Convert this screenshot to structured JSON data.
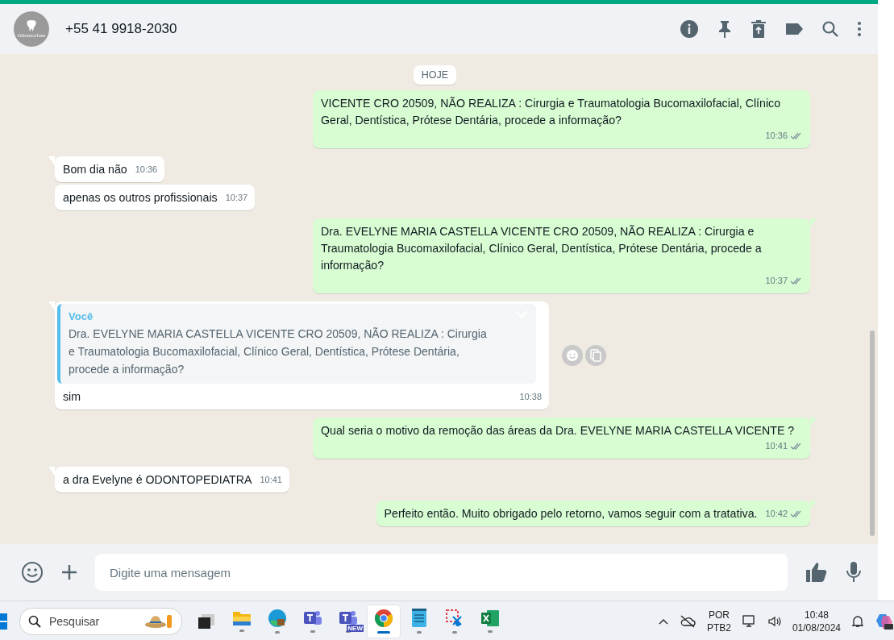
{
  "header": {
    "avatar_label": "Odontoclass",
    "title": "+55 41 9918-2030"
  },
  "date_chip": "HOJE",
  "messages": [
    {
      "kind": "out",
      "tail": false,
      "text": "VICENTE CRO 20509, NÃO REALIZA : Cirurgia e Traumatologia Bucomaxilofacial, Clínico Geral, Dentística, Prótese Dentária, procede a informação?",
      "time": "10:36"
    },
    {
      "kind": "in",
      "tail": true,
      "text": "Bom dia não",
      "time": "10:36"
    },
    {
      "kind": "in",
      "tail": false,
      "text": "apenas os outros profissionais",
      "time": "10:37"
    },
    {
      "kind": "out",
      "tail": true,
      "text": "Dra. EVELYNE MARIA CASTELLA VICENTE CRO 20509, NÃO REALIZA : Cirurgia e Traumatologia Bucomaxilofacial, Clínico Geral, Dentística, Prótese Dentária, procede a informação?",
      "time": "10:37"
    },
    {
      "kind": "quote",
      "tail": true,
      "quote_author": "Você",
      "quote_text": "Dra. EVELYNE MARIA CASTELLA VICENTE CRO 20509, NÃO REALIZA : Cirurgia e Traumatologia Bucomaxilofacial, Clínico Geral, Dentística, Prótese Dentária, procede a informação?",
      "text": "sim",
      "time": "10:38"
    },
    {
      "kind": "out",
      "tail": true,
      "text": "Qual seria o motivo da remoção das áreas da Dra. EVELYNE MARIA CASTELLA VICENTE ?",
      "time": "10:41"
    },
    {
      "kind": "in",
      "tail": true,
      "text": "a dra Evelyne é ODONTOPEDIATRA",
      "time": "10:41"
    },
    {
      "kind": "out",
      "tail": true,
      "text": "Perfeito então. Muito obrigado pelo retorno, vamos seguir com a tratativa.",
      "time": "10:42"
    }
  ],
  "composer": {
    "placeholder": "Digite uma mensagem"
  },
  "taskbar": {
    "search_placeholder": "Pesquisar",
    "apps": [
      {
        "kind": "taskview",
        "selected": false
      },
      {
        "kind": "folder",
        "selected": false
      },
      {
        "kind": "edge",
        "selected": false
      },
      {
        "kind": "teams",
        "selected": false
      },
      {
        "kind": "teams-new",
        "badge": "NEW",
        "selected": false
      },
      {
        "kind": "chrome",
        "selected": true
      },
      {
        "kind": "notepad",
        "selected": false
      },
      {
        "kind": "snip",
        "selected": false
      },
      {
        "kind": "excel",
        "selected": false
      }
    ],
    "lang": "POR",
    "layout": "PTB2",
    "time": "10:48",
    "date": "01/08/2024"
  }
}
